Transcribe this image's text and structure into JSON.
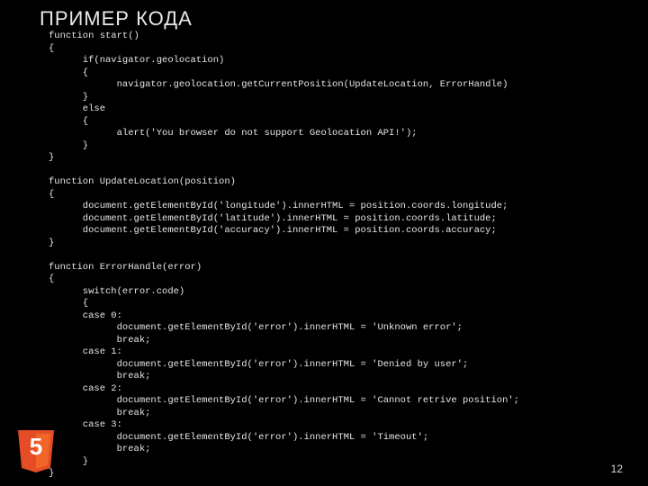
{
  "title": "ПРИМЕР КОДА",
  "page_number": "12",
  "logo": {
    "name": "html5-logo",
    "glyph": "5"
  },
  "code": "function start()\n{\n      if(navigator.geolocation)\n      {\n            navigator.geolocation.getCurrentPosition(UpdateLocation, ErrorHandle)\n      }\n      else\n      {\n            alert('You browser do not support Geolocation API!');\n      }\n}\n\nfunction UpdateLocation(position)\n{\n      document.getElementById('longitude').innerHTML = position.coords.longitude;\n      document.getElementById('latitude').innerHTML = position.coords.latitude;\n      document.getElementById('accuracy').innerHTML = position.coords.accuracy;\n}\n\nfunction ErrorHandle(error)\n{\n      switch(error.code)\n      {\n      case 0:\n            document.getElementById('error').innerHTML = 'Unknown error';\n            break;\n      case 1:\n            document.getElementById('error').innerHTML = 'Denied by user';\n            break;\n      case 2:\n            document.getElementById('error').innerHTML = 'Cannot retrive position';\n            break;\n      case 3:\n            document.getElementById('error').innerHTML = 'Timeout';\n            break;\n      }\n}"
}
